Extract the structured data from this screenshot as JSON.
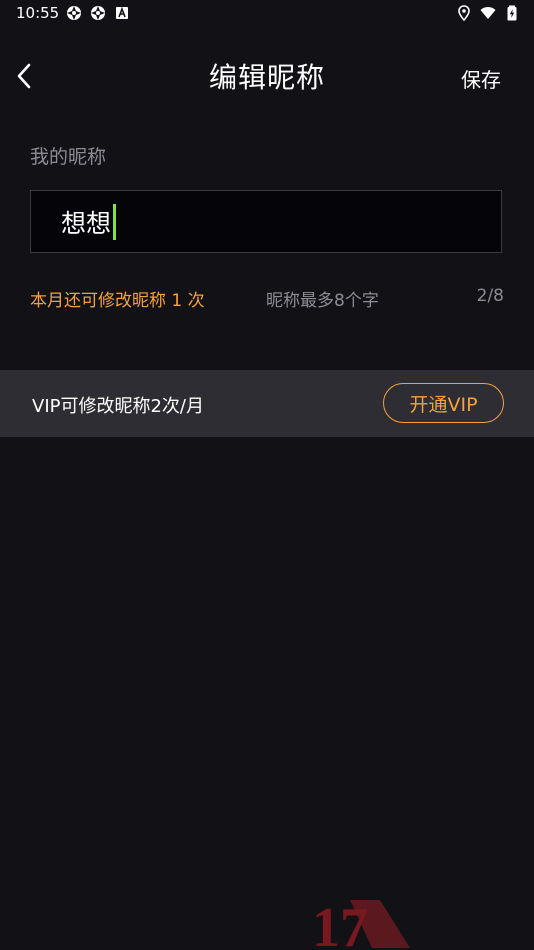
{
  "status_bar": {
    "time": "10:55",
    "left_icons": [
      "app-notification-icon",
      "app-notification-icon",
      "text-a-icon"
    ],
    "right_icons": [
      "location-icon",
      "wifi-icon",
      "battery-charging-icon"
    ]
  },
  "header": {
    "title": "编辑昵称",
    "save_label": "保存",
    "back_icon": "chevron-left-icon"
  },
  "nickname": {
    "section_label": "我的昵称",
    "value": "想想",
    "remaining_hint": "本月还可修改昵称 1 次",
    "max_length_hint": "昵称最多8个字",
    "char_count": "2/8"
  },
  "vip": {
    "text": "VIP可修改昵称2次/月",
    "button_label": "开通VIP"
  },
  "colors": {
    "background": "#121116",
    "accent": "#f5a13d",
    "cursor": "#7ee34a",
    "banner": "#2e2d33",
    "muted_text": "#8d8c92"
  }
}
